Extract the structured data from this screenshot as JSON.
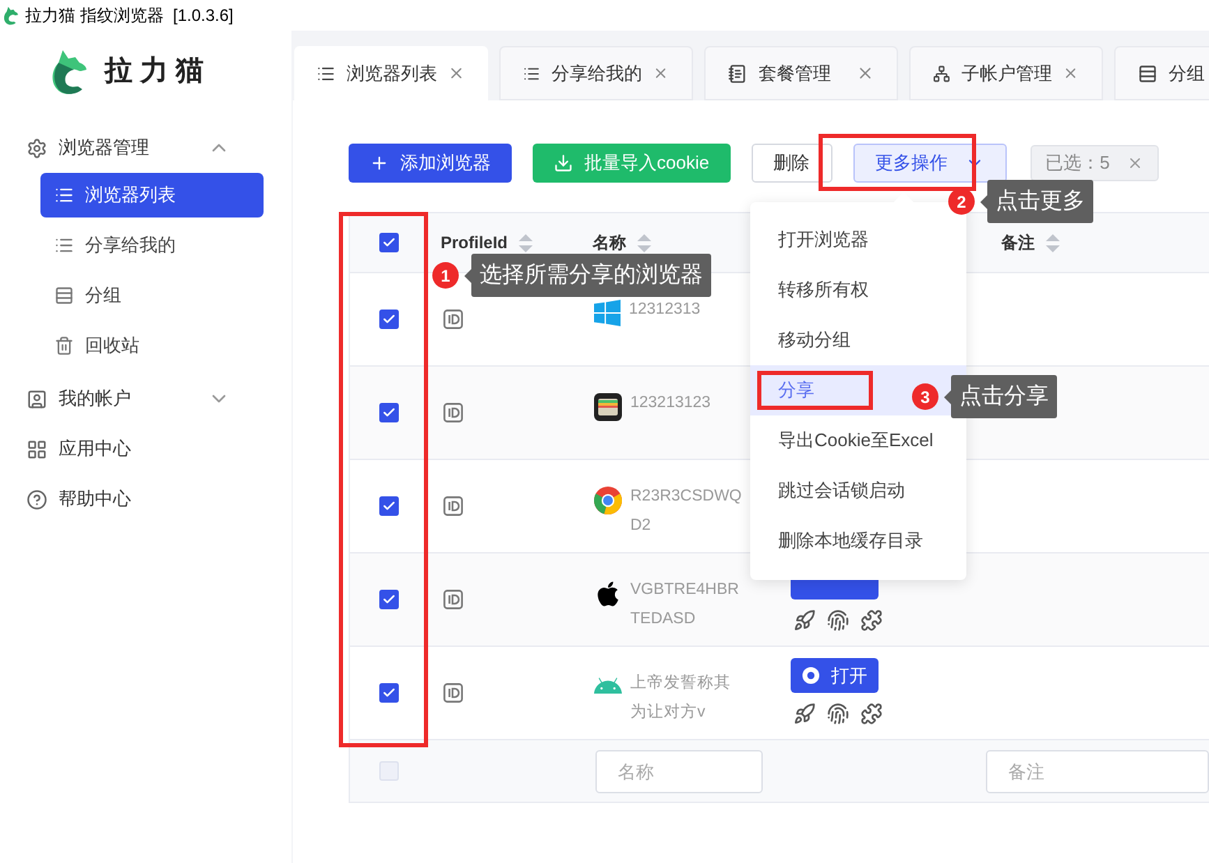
{
  "window": {
    "title": "拉力猫 指纹浏览器  [1.0.3.6]"
  },
  "sidebar": {
    "logo": "拉 力 猫",
    "items": [
      {
        "label": "浏览器管理",
        "expanded": true,
        "children": [
          {
            "label": "浏览器列表",
            "selected": true
          },
          {
            "label": "分享给我的",
            "selected": false
          },
          {
            "label": "分组",
            "selected": false
          },
          {
            "label": "回收站",
            "selected": false
          }
        ]
      },
      {
        "label": "我的帐户",
        "expanded": false
      },
      {
        "label": "应用中心"
      },
      {
        "label": "帮助中心"
      }
    ]
  },
  "tabs": [
    {
      "label": "浏览器列表",
      "selected": true
    },
    {
      "label": "分享给我的",
      "selected": false
    },
    {
      "label": "套餐管理",
      "selected": false
    },
    {
      "label": "子帐户管理",
      "selected": false
    },
    {
      "label": "分组",
      "selected": false
    }
  ],
  "toolbar": {
    "buttons": [
      {
        "label": "添加浏览器",
        "kind": "primary"
      },
      {
        "label": "批量导入cookie",
        "kind": "success"
      },
      {
        "label": "删除",
        "kind": "plain"
      },
      {
        "label": "更多操作",
        "kind": "dropdown"
      }
    ],
    "selected_count": "已选：5"
  },
  "table": {
    "select_all": true,
    "columns": [
      "ProfileId",
      "名称",
      "备注"
    ],
    "rows": [
      {
        "kind": "windows",
        "name": "12312313",
        "checked": true
      },
      {
        "kind": "wallet",
        "name": "123213123",
        "checked": true
      },
      {
        "kind": "chrome",
        "name": "R23R3CSDWQD2",
        "checked": true
      },
      {
        "kind": "apple",
        "name": "VGBTRE4HBRTEDASD",
        "checked": true,
        "covered_open_button": true
      },
      {
        "kind": "android",
        "name": "上帝发誓称其为让对方v",
        "checked": true,
        "open_button": "打开"
      }
    ],
    "filter_row": {
      "checked": false,
      "fields": [
        {
          "placeholder": "名称"
        },
        {
          "placeholder": "备注"
        }
      ]
    }
  },
  "dropdown_menu": {
    "items": [
      {
        "label": "打开浏览器",
        "selected": false
      },
      {
        "label": "转移所有权",
        "selected": false
      },
      {
        "label": "移动分组",
        "selected": false
      },
      {
        "label": "分享",
        "selected": true
      },
      {
        "label": "导出Cookie至Excel",
        "selected": false
      },
      {
        "label": "跳过会话锁启动",
        "selected": false
      },
      {
        "label": "删除本地缓存目录",
        "selected": false
      }
    ]
  },
  "callouts": [
    {
      "number": "1",
      "text": "选择所需分享的浏览器"
    },
    {
      "number": "2",
      "text": "点击更多"
    },
    {
      "number": "3",
      "text": "点击分享"
    }
  ]
}
